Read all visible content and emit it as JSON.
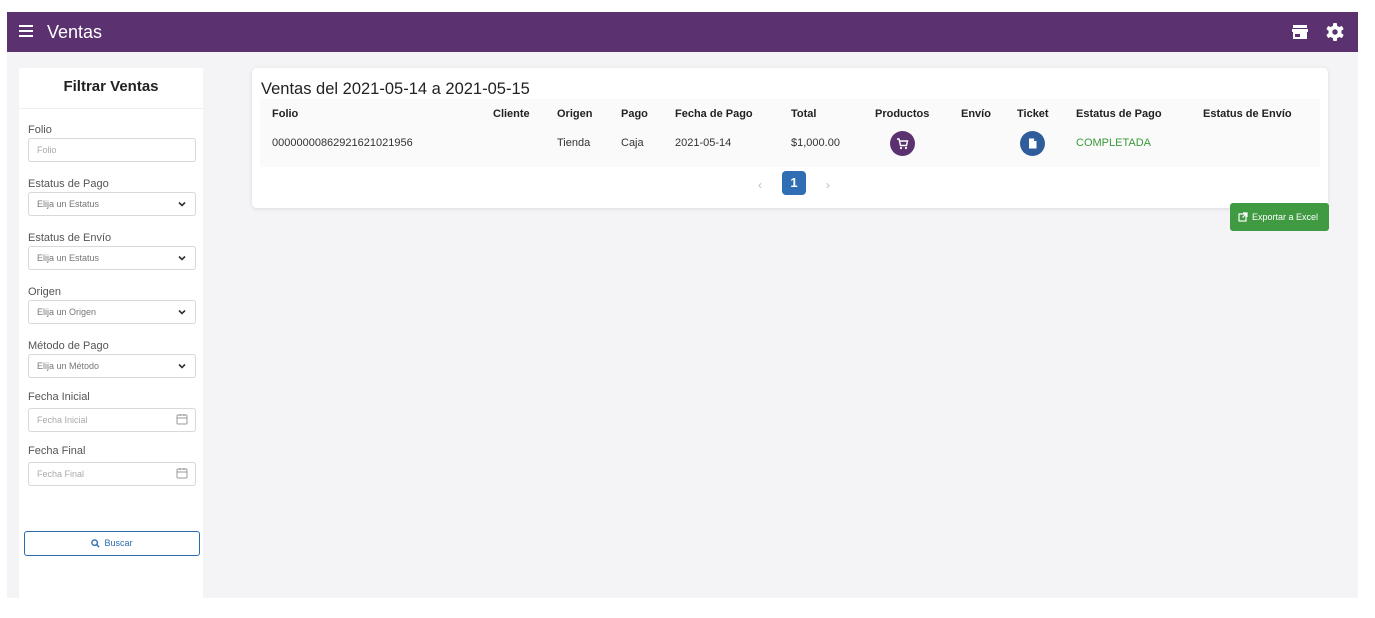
{
  "topbar": {
    "title": "Ventas",
    "bg_color": "#5b3170",
    "icons": [
      "menu-icon",
      "store-icon",
      "gear-icon"
    ]
  },
  "sidebar": {
    "title": "Filtrar Ventas",
    "folio": {
      "label": "Folio",
      "placeholder": "Folio"
    },
    "estatus_pago": {
      "label": "Estatus de Pago",
      "value": "Elija un Estatus"
    },
    "estatus_envio": {
      "label": "Estatus de Envío",
      "value": "Elija un Estatus"
    },
    "origen": {
      "label": "Origen",
      "value": "Elija un Origen"
    },
    "metodo_pago": {
      "label": "Método de Pago",
      "value": "Elija un Método"
    },
    "fecha_inicial": {
      "label": "Fecha Inicial",
      "placeholder": "Fecha Inicial"
    },
    "fecha_final": {
      "label": "Fecha Final",
      "placeholder": "Fecha Final"
    },
    "search_label": "Buscar"
  },
  "main": {
    "title": "Ventas del 2021-05-14 a 2021-05-15",
    "columns": [
      "Folio",
      "Cliente",
      "Origen",
      "Pago",
      "Fecha de Pago",
      "Total",
      "Productos",
      "Envío",
      "Ticket",
      "Estatus de Pago",
      "Estatus de Envío"
    ],
    "rows": [
      {
        "folio": "00000000862921621021956",
        "cliente": "",
        "origen": "Tienda",
        "pago": "Caja",
        "fecha_pago": "2021-05-14",
        "total": "$1,000.00",
        "envio": "",
        "estatus_pago": "COMPLETADA",
        "estatus_envio": ""
      }
    ],
    "pagination": {
      "current_page": "1",
      "prev": "‹",
      "next": "›"
    },
    "export_label": "Exportar a Excel",
    "colors": {
      "accent": "#5b3170",
      "primary": "#2f6db5",
      "success": "#3f9a42",
      "status_green": "#3a9a3a"
    }
  }
}
